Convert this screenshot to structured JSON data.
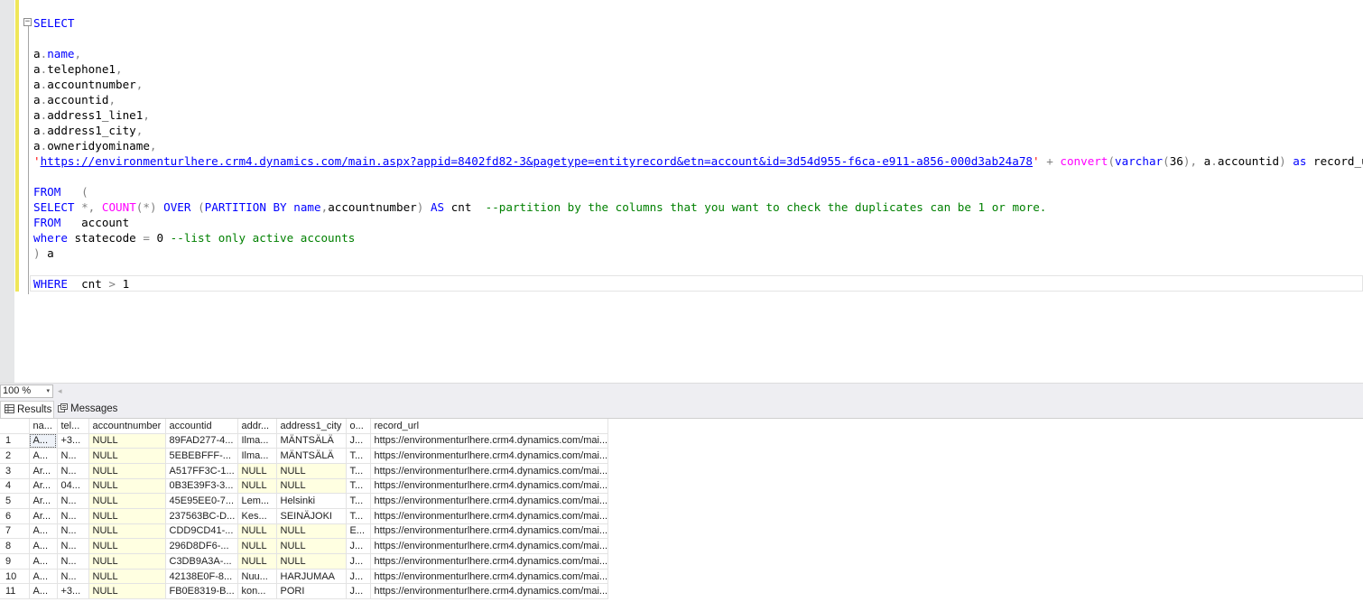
{
  "editor": {
    "lines": [
      [
        {
          "t": "SELECT",
          "c": "kw"
        }
      ],
      [],
      [
        {
          "t": "a",
          "c": ""
        },
        {
          "t": ".",
          "c": "gy"
        },
        {
          "t": "name",
          "c": "kw"
        },
        {
          "t": ",",
          "c": "gy"
        }
      ],
      [
        {
          "t": "a",
          "c": ""
        },
        {
          "t": ".",
          "c": "gy"
        },
        {
          "t": "telephone1",
          "c": ""
        },
        {
          "t": ",",
          "c": "gy"
        }
      ],
      [
        {
          "t": "a",
          "c": ""
        },
        {
          "t": ".",
          "c": "gy"
        },
        {
          "t": "accountnumber",
          "c": ""
        },
        {
          "t": ",",
          "c": "gy"
        }
      ],
      [
        {
          "t": "a",
          "c": ""
        },
        {
          "t": ".",
          "c": "gy"
        },
        {
          "t": "accountid",
          "c": ""
        },
        {
          "t": ",",
          "c": "gy"
        }
      ],
      [
        {
          "t": "a",
          "c": ""
        },
        {
          "t": ".",
          "c": "gy"
        },
        {
          "t": "address1_line1",
          "c": ""
        },
        {
          "t": ",",
          "c": "gy"
        }
      ],
      [
        {
          "t": "a",
          "c": ""
        },
        {
          "t": ".",
          "c": "gy"
        },
        {
          "t": "address1_city",
          "c": ""
        },
        {
          "t": ",",
          "c": "gy"
        }
      ],
      [
        {
          "t": "a",
          "c": ""
        },
        {
          "t": ".",
          "c": "gy"
        },
        {
          "t": "owneridyominame",
          "c": ""
        },
        {
          "t": ",",
          "c": "gy"
        }
      ],
      [
        {
          "t": "'",
          "c": "st"
        },
        {
          "t": "https://environmenturlhere.crm4.dynamics.com/main.aspx?appid=8402fd82-3&pagetype=entityrecord&etn=account&id=3d54d955-f6ca-e911-a856-000d3ab24a78",
          "c": "lnk"
        },
        {
          "t": "'",
          "c": "st"
        },
        {
          "t": " ",
          "c": ""
        },
        {
          "t": "+",
          "c": "gy"
        },
        {
          "t": " ",
          "c": ""
        },
        {
          "t": "convert",
          "c": "fn"
        },
        {
          "t": "(",
          "c": "gy"
        },
        {
          "t": "varchar",
          "c": "kw"
        },
        {
          "t": "(",
          "c": "gy"
        },
        {
          "t": "36",
          "c": ""
        },
        {
          "t": "),",
          "c": "gy"
        },
        {
          "t": " a",
          "c": ""
        },
        {
          "t": ".",
          "c": "gy"
        },
        {
          "t": "accountid",
          "c": ""
        },
        {
          "t": ")",
          "c": "gy"
        },
        {
          "t": " ",
          "c": ""
        },
        {
          "t": "as",
          "c": "kw"
        },
        {
          "t": " record_url",
          "c": ""
        }
      ],
      [],
      [
        {
          "t": "FROM",
          "c": "kw"
        },
        {
          "t": "   ",
          "c": ""
        },
        {
          "t": "(",
          "c": "gy"
        }
      ],
      [
        {
          "t": "SELECT",
          "c": "kw"
        },
        {
          "t": " ",
          "c": ""
        },
        {
          "t": "*,",
          "c": "gy"
        },
        {
          "t": " ",
          "c": ""
        },
        {
          "t": "COUNT",
          "c": "fn"
        },
        {
          "t": "(*)",
          "c": "gy"
        },
        {
          "t": " ",
          "c": ""
        },
        {
          "t": "OVER",
          "c": "kw"
        },
        {
          "t": " ",
          "c": ""
        },
        {
          "t": "(",
          "c": "gy"
        },
        {
          "t": "PARTITION BY",
          "c": "kw"
        },
        {
          "t": " ",
          "c": ""
        },
        {
          "t": "name",
          "c": "kw"
        },
        {
          "t": ",",
          "c": "gy"
        },
        {
          "t": "accountnumber",
          "c": ""
        },
        {
          "t": ")",
          "c": "gy"
        },
        {
          "t": " ",
          "c": ""
        },
        {
          "t": "AS",
          "c": "kw"
        },
        {
          "t": " cnt  ",
          "c": ""
        },
        {
          "t": "--partition by the columns that you want to check the duplicates can be 1 or more.",
          "c": "cm"
        }
      ],
      [
        {
          "t": "FROM",
          "c": "kw"
        },
        {
          "t": "   account",
          "c": ""
        }
      ],
      [
        {
          "t": "where",
          "c": "kw"
        },
        {
          "t": " statecode ",
          "c": ""
        },
        {
          "t": "=",
          "c": "gy"
        },
        {
          "t": " 0 ",
          "c": ""
        },
        {
          "t": "--list only active accounts",
          "c": "cm"
        }
      ],
      [
        {
          "t": ")",
          "c": "gy"
        },
        {
          "t": " a",
          "c": ""
        }
      ],
      [],
      [
        {
          "t": "WHERE",
          "c": "kw"
        },
        {
          "t": "  cnt ",
          "c": ""
        },
        {
          "t": ">",
          "c": "gy"
        },
        {
          "t": " 1",
          "c": ""
        }
      ]
    ],
    "collapse_glyph": "−"
  },
  "zoom": {
    "value": "100 %",
    "arrow": "▾",
    "scroll_left": "◂"
  },
  "tabs": {
    "results": "Results",
    "messages": "Messages"
  },
  "grid": {
    "columns": [
      "",
      "na...",
      "tel...",
      "accountnumber",
      "accountid",
      "addr...",
      "address1_city",
      "o...",
      "record_url"
    ],
    "rows": [
      [
        "1",
        "A...",
        "+3...",
        "NULL",
        "89FAD277-4...",
        "Ilma...",
        "MÄNTSÄLÄ",
        "J...",
        "https://environmenturlhere.crm4.dynamics.com/mai..."
      ],
      [
        "2",
        "A...",
        "N...",
        "NULL",
        "5EBEBFFF-...",
        "Ilma...",
        "MÄNTSÄLÄ",
        "T...",
        "https://environmenturlhere.crm4.dynamics.com/mai..."
      ],
      [
        "3",
        "Ar...",
        "N...",
        "NULL",
        "A517FF3C-1...",
        "NULL",
        "NULL",
        "T...",
        "https://environmenturlhere.crm4.dynamics.com/mai..."
      ],
      [
        "4",
        "Ar...",
        "04...",
        "NULL",
        "0B3E39F3-3...",
        "NULL",
        "NULL",
        "T...",
        "https://environmenturlhere.crm4.dynamics.com/mai..."
      ],
      [
        "5",
        "Ar...",
        "N...",
        "NULL",
        "45E95EE0-7...",
        "Lem...",
        "Helsinki",
        "T...",
        "https://environmenturlhere.crm4.dynamics.com/mai..."
      ],
      [
        "6",
        "Ar...",
        "N...",
        "NULL",
        "237563BC-D...",
        "Kes...",
        "SEINÄJOKI",
        "T...",
        "https://environmenturlhere.crm4.dynamics.com/mai..."
      ],
      [
        "7",
        "A...",
        "N...",
        "NULL",
        "CDD9CD41-...",
        "NULL",
        "NULL",
        "E...",
        "https://environmenturlhere.crm4.dynamics.com/mai..."
      ],
      [
        "8",
        "A...",
        "N...",
        "NULL",
        "296D8DF6-...",
        "NULL",
        "NULL",
        "J...",
        "https://environmenturlhere.crm4.dynamics.com/mai..."
      ],
      [
        "9",
        "A...",
        "N...",
        "NULL",
        "C3DB9A3A-...",
        "NULL",
        "NULL",
        "J...",
        "https://environmenturlhere.crm4.dynamics.com/mai..."
      ],
      [
        "10",
        "A...",
        "N...",
        "NULL",
        "42138E0F-8...",
        "Nuu...",
        "HARJUMAA",
        "J...",
        "https://environmenturlhere.crm4.dynamics.com/mai..."
      ],
      [
        "11",
        "A...",
        "+3...",
        "NULL",
        "FB0E8319-B...",
        "kon...",
        "PORI",
        "J...",
        "https://environmenturlhere.crm4.dynamics.com/mai..."
      ]
    ],
    "null_color": "#ffffe1",
    "selected_cell": [
      0,
      1
    ]
  }
}
